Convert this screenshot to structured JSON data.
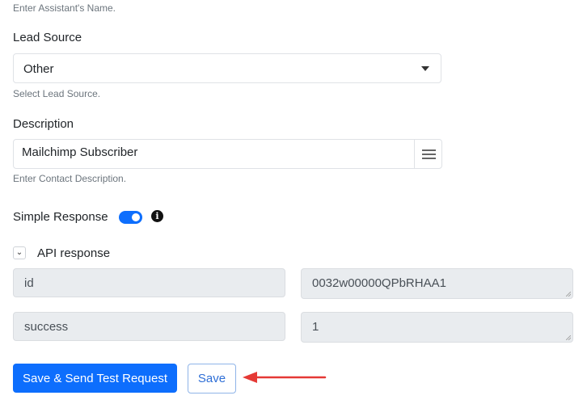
{
  "assistant_name": {
    "help": "Enter Assistant's Name."
  },
  "lead_source": {
    "label": "Lead Source",
    "selected": "Other",
    "help": "Select Lead Source."
  },
  "description": {
    "label": "Description",
    "value": "Mailchimp Subscriber",
    "help": "Enter Contact Description."
  },
  "simple_response": {
    "label": "Simple Response",
    "enabled": true,
    "info_glyph": "i"
  },
  "api_response": {
    "label": "API response",
    "chevron_glyph": "⌄",
    "rows": [
      {
        "key": "id",
        "value": "0032w00000QPbRHAA1"
      },
      {
        "key": "success",
        "value": "1"
      }
    ]
  },
  "actions": {
    "save_send_label": "Save & Send Test Request",
    "save_label": "Save"
  },
  "colors": {
    "primary": "#0d6efd",
    "arrow": "#e53935"
  }
}
